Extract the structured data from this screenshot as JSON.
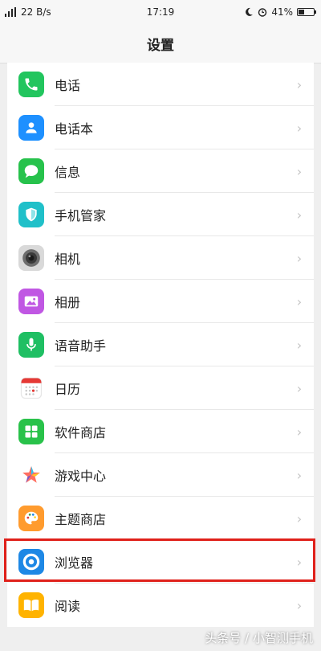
{
  "status": {
    "signal": "22 B/s",
    "time": "17:19",
    "battery": "41%",
    "battery_level": 0.41
  },
  "header": {
    "title": "设置"
  },
  "items": [
    {
      "label": "电话",
      "icon": "phone-icon",
      "color": "#22c55e"
    },
    {
      "label": "电话本",
      "icon": "contacts-icon",
      "color": "#1e90ff"
    },
    {
      "label": "信息",
      "icon": "message-icon",
      "color": "#27c24c"
    },
    {
      "label": "手机管家",
      "icon": "shield-icon",
      "color": "#20c0c9"
    },
    {
      "label": "相机",
      "icon": "camera-icon",
      "color": "#d9d9d9"
    },
    {
      "label": "相册",
      "icon": "gallery-icon",
      "color": "#c057e3"
    },
    {
      "label": "语音助手",
      "icon": "microphone-icon",
      "color": "#1fbf63"
    },
    {
      "label": "日历",
      "icon": "calendar-icon",
      "color": "#ffffff"
    },
    {
      "label": "软件商店",
      "icon": "app-store-icon",
      "color": "#29c24a"
    },
    {
      "label": "游戏中心",
      "icon": "game-center-icon",
      "color": "#ffffff"
    },
    {
      "label": "主题商店",
      "icon": "palette-icon",
      "color": "#ff9b2e"
    },
    {
      "label": "浏览器",
      "icon": "browser-icon",
      "color": "#1e88e5"
    },
    {
      "label": "阅读",
      "icon": "book-icon",
      "color": "#ffb300"
    }
  ],
  "watermark": "头条号 / 小智测手机",
  "highlight_color": "#e0211b"
}
